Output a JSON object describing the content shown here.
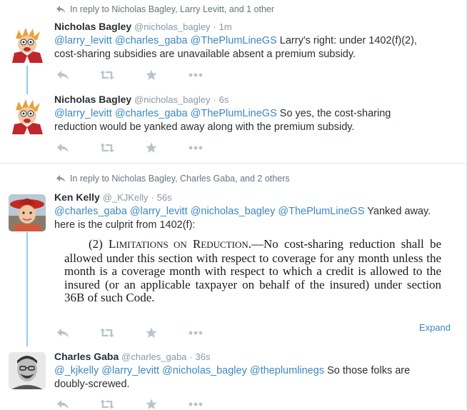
{
  "stream": {
    "reply_context_1": "In reply to Nicholas Bagley, Larry Levitt, and 1 other",
    "reply_context_2": "In reply to Nicholas Bagley, Charles Gaba, and 2 others",
    "expand_label": "Expand"
  },
  "tweets": [
    {
      "name": "Nicholas Bagley",
      "handle": "@nicholas_bagley",
      "sep": "·",
      "time": "1m",
      "mentions": [
        "@larry_levitt",
        "@charles_gaba",
        "@ThePlumLineGS"
      ],
      "text_line1_rest": "Larry's right: under 1402(f)(2),",
      "text_line2": "cost-sharing subsidies are unavailable absent a premium subsidy."
    },
    {
      "name": "Nicholas Bagley",
      "handle": "@nicholas_bagley",
      "sep": "·",
      "time": "6s",
      "mentions": [
        "@larry_levitt",
        "@charles_gaba",
        "@ThePlumLineGS"
      ],
      "text_line1_rest": "So yes, the cost-sharing",
      "text_line2": "reduction would be yanked away along with the premium subsidy."
    },
    {
      "name": "Ken Kelly",
      "handle": "@_KJKelly",
      "sep": "·",
      "time": "56s",
      "mentions": [
        "@charles_gaba",
        "@larry_levitt",
        "@nicholas_bagley",
        "@ThePlumLineGS"
      ],
      "text_line1_rest": "Yanked away.",
      "text_line2": "here is the culprit from 1402(f):",
      "quote": {
        "lead": "(2) L",
        "smallcaps1": "IMITATIONS ON",
        "mid": " R",
        "smallcaps2": "EDUCTION",
        "body": ".—No cost-sharing reduction shall be allowed under this section with respect to coverage for any month unless the month is a coverage month with respect to which a credit is allowed to the insured (or an applicable taxpayer on behalf of the insured) under section 36B of such Code."
      }
    },
    {
      "name": "Charles Gaba",
      "handle": "@charles_gaba",
      "sep": "·",
      "time": "36s",
      "mentions": [
        "@_kjkelly",
        "@larry_levitt",
        "@nicholas_bagley",
        "@theplumlinegs"
      ],
      "text_line1_rest": "So those folks are",
      "text_line2": "doubly-screwed."
    }
  ],
  "icons": [
    "reply-icon",
    "retweet-icon",
    "favorite-icon",
    "more-icon"
  ],
  "colors": {
    "link": "#3b88c3",
    "thread_line": "#8ecdf0",
    "action_icon": "#b8c4cc",
    "meta": "#8899a6"
  }
}
